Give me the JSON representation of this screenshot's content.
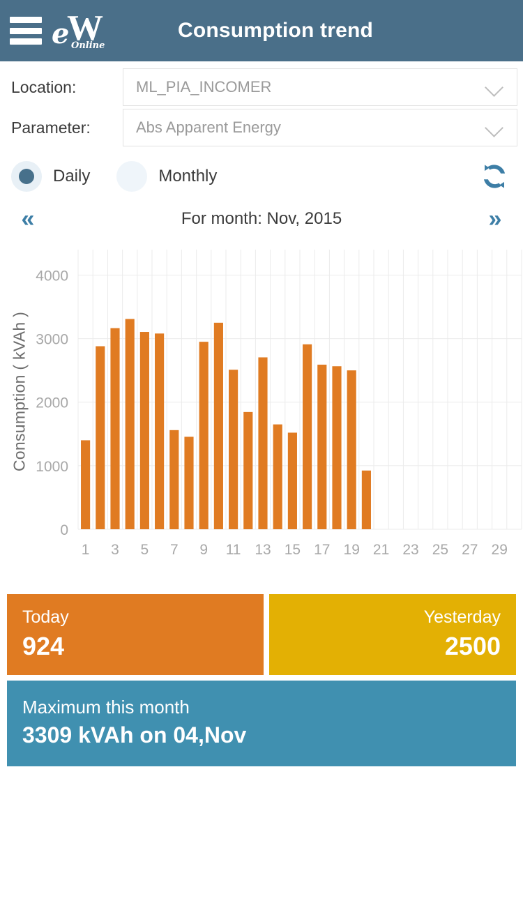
{
  "header": {
    "menu_icon": "hamburger-menu-icon",
    "logo": {
      "mark_e": "e",
      "mark_w": "W",
      "sub": "Online"
    },
    "title": "Consumption trend"
  },
  "filters": {
    "location": {
      "label": "Location:",
      "value": "ML_PIA_INCOMER",
      "chevron_icon": "chevron-down-icon"
    },
    "parameter": {
      "label": "Parameter:",
      "value": "Abs Apparent Energy",
      "chevron_icon": "chevron-down-icon"
    }
  },
  "mode": {
    "daily_label": "Daily",
    "monthly_label": "Monthly",
    "selected": "Daily",
    "refresh_icon": "refresh-icon"
  },
  "month_nav": {
    "prev_label": "«",
    "next_label": "»",
    "current_label": "For month: Nov, 2015"
  },
  "chart_data": {
    "type": "bar",
    "title": "",
    "xlabel": "",
    "ylabel": "Consumption ( kVAh )",
    "categories": [
      1,
      2,
      3,
      4,
      5,
      6,
      7,
      8,
      9,
      10,
      11,
      12,
      13,
      14,
      15,
      16,
      17,
      18,
      19,
      20,
      21,
      22,
      23,
      24,
      25,
      26,
      27,
      28,
      29,
      30
    ],
    "values": [
      1400,
      2880,
      3165,
      3309,
      3105,
      3080,
      1560,
      1455,
      2950,
      3250,
      2510,
      1845,
      2705,
      1650,
      1520,
      2910,
      2590,
      2565,
      2500,
      924,
      null,
      null,
      null,
      null,
      null,
      null,
      null,
      null,
      null,
      null
    ],
    "xticks": [
      1,
      3,
      5,
      7,
      9,
      11,
      13,
      15,
      17,
      19,
      21,
      23,
      25,
      27,
      29
    ],
    "yticks": [
      0,
      1000,
      2000,
      3000,
      4000
    ],
    "ylim": [
      0,
      4400
    ],
    "grid": true,
    "legend": false,
    "bar_color": "#e07b22",
    "grid_color": "#ebebeb",
    "tick_color": "#a8a8a8"
  },
  "stats": {
    "today": {
      "title": "Today",
      "value": "924"
    },
    "yesterday": {
      "title": "Yesterday",
      "value": "2500"
    },
    "maximum": {
      "title": "Maximum this month",
      "value": "3309 kVAh on 04,Nov"
    }
  },
  "colors": {
    "header_bg": "#4a6f89",
    "accent_orange": "#e07b22",
    "accent_yellow": "#e3b004",
    "accent_blue": "#4090b0"
  }
}
